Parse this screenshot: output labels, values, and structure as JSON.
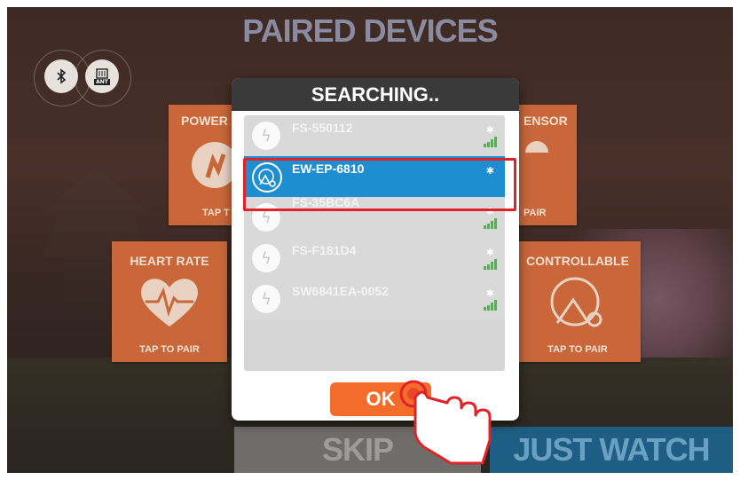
{
  "screen": {
    "title": "PAIRED DEVICES",
    "bluetooth_badge": "✱",
    "ant_badge": "ANT"
  },
  "tiles": {
    "power": {
      "label": "POWER",
      "tap": "TAP T"
    },
    "sensor": {
      "label": "ENSOR",
      "tap": "PAIR"
    },
    "heart_rate": {
      "label": "HEART RATE",
      "tap": "TAP TO PAIR"
    },
    "controllable": {
      "label": "CONTROLLABLE",
      "tap": "TAP TO PAIR"
    }
  },
  "modal": {
    "title": "SEARCHING..",
    "devices": [
      {
        "name": "FS-550112",
        "selected": false
      },
      {
        "name": "EW-EP-6810",
        "selected": true
      },
      {
        "name": "FS-35BC6A",
        "selected": false
      },
      {
        "name": "FS-F181D4",
        "selected": false
      },
      {
        "name": "SW6841EA-0052",
        "selected": false
      }
    ],
    "ok_label": "OK"
  },
  "bottom": {
    "skip_label": "SKIP",
    "watch_label": "JUST WATCH"
  },
  "colors": {
    "tile": "#c9673a",
    "selected_row": "#1f8ed0",
    "ok": "#f36c2a",
    "highlight": "#e0222a",
    "just_watch": "#1f5e84"
  }
}
